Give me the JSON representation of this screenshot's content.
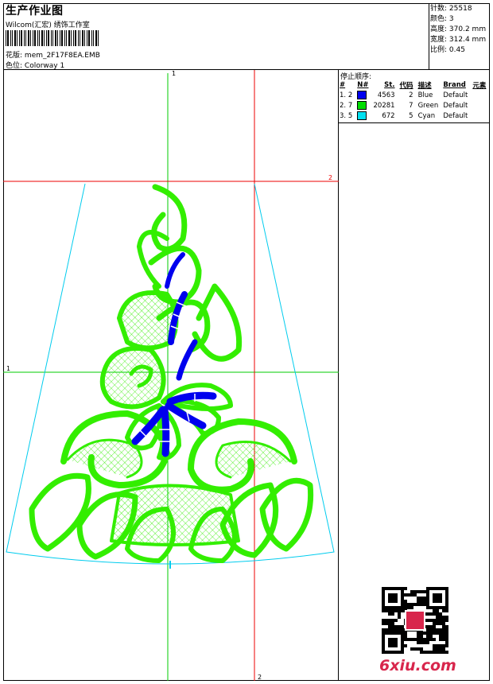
{
  "header": {
    "title": "生产作业图",
    "company": "Wilcom(汇宏) 绣饰工作室",
    "design_label": "花版:",
    "design_value": "mem_2F17F8EA.EMB",
    "colorway_label": "色位:",
    "colorway_value": "Colorway 1"
  },
  "stats": [
    {
      "label": "针数:",
      "value": "25518"
    },
    {
      "label": "颜色:",
      "value": "3"
    },
    {
      "label": "高度:",
      "value": "370.2 mm"
    },
    {
      "label": "宽度:",
      "value": "312.4 mm"
    },
    {
      "label": "比例:",
      "value": "0.45"
    }
  ],
  "stop_sequence": {
    "title": "停止顺序:",
    "columns": [
      "#",
      "N#",
      "St.",
      "代码",
      "描述",
      "Brand",
      "元素"
    ],
    "rows": [
      {
        "idx": "1.",
        "n": "2",
        "st": "4563",
        "code": "2",
        "desc": "Blue",
        "brand": "Default",
        "color": "#0000ee"
      },
      {
        "idx": "2.",
        "n": "7",
        "st": "20281",
        "code": "7",
        "desc": "Green",
        "brand": "Default",
        "color": "#00dd00"
      },
      {
        "idx": "3.",
        "n": "5",
        "st": "672",
        "code": "5",
        "desc": "Cyan",
        "brand": "Default",
        "color": "#00e0f0"
      }
    ]
  },
  "axes": {
    "v_green_label": "1",
    "h_red_label": "2",
    "h_green_label": "1",
    "v_red_label": "2"
  },
  "colors": {
    "green": "#33ee00",
    "blue": "#0000ee",
    "cyan": "#00ccee",
    "red": "#ee0000",
    "guide_green": "#00cc00"
  },
  "watermark": "6xiu.com"
}
